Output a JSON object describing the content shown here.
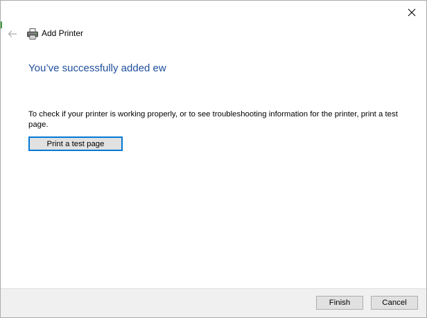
{
  "window": {
    "close_icon": "close-icon"
  },
  "header": {
    "back_icon": "back-arrow-icon",
    "printer_icon": "printer-icon",
    "title": "Add Printer"
  },
  "main": {
    "heading": "You’ve successfully added ew",
    "description": "To check if your printer is working properly, or to see troubleshooting information for the printer, print a test page.",
    "test_page_button": "Print a test page"
  },
  "footer": {
    "finish_label": "Finish",
    "cancel_label": "Cancel"
  },
  "colors": {
    "heading": "#1f4e9c",
    "focus_border": "#0078d7",
    "button_bg": "#e1e1e1",
    "footer_bg": "#f0f0f0"
  }
}
